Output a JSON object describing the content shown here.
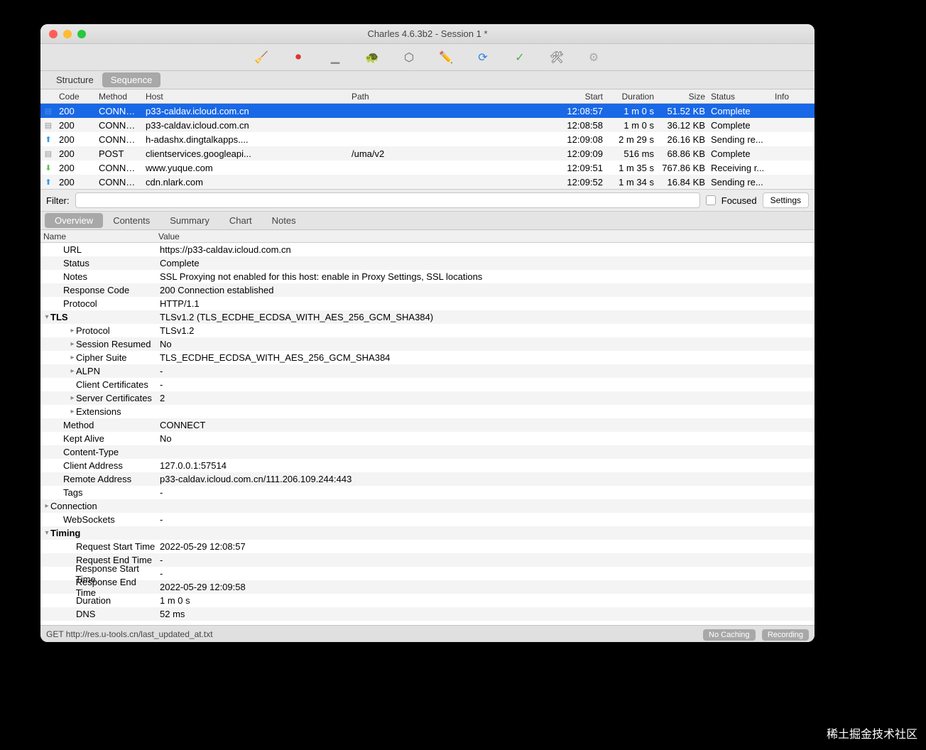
{
  "window": {
    "title": "Charles 4.6.3b2 - Session 1 *"
  },
  "modeTabs": {
    "structure": "Structure",
    "sequence": "Sequence"
  },
  "columns": {
    "code": "Code",
    "method": "Method",
    "host": "Host",
    "path": "Path",
    "start": "Start",
    "duration": "Duration",
    "size": "Size",
    "status": "Status",
    "info": "Info"
  },
  "rows": [
    {
      "icon": "doc",
      "iconColor": "#4a90e2",
      "code": "200",
      "method": "CONNECT",
      "host": "p33-caldav.icloud.com.cn",
      "path": "",
      "start": "12:08:57",
      "duration": "1 m 0 s",
      "size": "51.52 KB",
      "status": "Complete",
      "selected": true
    },
    {
      "icon": "doc",
      "iconColor": "#999",
      "code": "200",
      "method": "CONNECT",
      "host": "p33-caldav.icloud.com.cn",
      "path": "",
      "start": "12:08:58",
      "duration": "1 m 0 s",
      "size": "36.12 KB",
      "status": "Complete"
    },
    {
      "icon": "up",
      "iconColor": "#2e9ae6",
      "code": "200",
      "method": "CONNECT",
      "host": "h-adashx.dingtalkapps....",
      "path": "",
      "start": "12:09:08",
      "duration": "2 m 29 s",
      "size": "26.16 KB",
      "status": "Sending re..."
    },
    {
      "icon": "doc",
      "iconColor": "#999",
      "code": "200",
      "method": "POST",
      "host": "clientservices.googleapi...",
      "path": "/uma/v2",
      "start": "12:09:09",
      "duration": "516 ms",
      "size": "68.86 KB",
      "status": "Complete"
    },
    {
      "icon": "down",
      "iconColor": "#5fc24a",
      "code": "200",
      "method": "CONNECT",
      "host": "www.yuque.com",
      "path": "",
      "start": "12:09:51",
      "duration": "1 m 35 s",
      "size": "767.86 KB",
      "status": "Receiving r..."
    },
    {
      "icon": "up",
      "iconColor": "#2e9ae6",
      "code": "200",
      "method": "CONNECT",
      "host": "cdn.nlark.com",
      "path": "",
      "start": "12:09:52",
      "duration": "1 m 34 s",
      "size": "16.84 KB",
      "status": "Sending re..."
    }
  ],
  "filter": {
    "label": "Filter:",
    "focused": "Focused",
    "settings": "Settings"
  },
  "detailTabs": {
    "overview": "Overview",
    "contents": "Contents",
    "summary": "Summary",
    "chart": "Chart",
    "notes": "Notes"
  },
  "ovHeader": {
    "name": "Name",
    "value": "Value"
  },
  "overview": [
    {
      "indent": 1,
      "name": "URL",
      "value": "https://p33-caldav.icloud.com.cn"
    },
    {
      "indent": 1,
      "name": "Status",
      "value": "Complete"
    },
    {
      "indent": 1,
      "name": "Notes",
      "value": "SSL Proxying not enabled for this host: enable in Proxy Settings, SSL locations"
    },
    {
      "indent": 1,
      "name": "Response Code",
      "value": "200 Connection established"
    },
    {
      "indent": 1,
      "name": "Protocol",
      "value": "HTTP/1.1"
    },
    {
      "indent": 0,
      "disc": "open",
      "bold": true,
      "name": "TLS",
      "value": "TLSv1.2 (TLS_ECDHE_ECDSA_WITH_AES_256_GCM_SHA384)"
    },
    {
      "indent": 2,
      "disc": "closed",
      "name": "Protocol",
      "value": "TLSv1.2"
    },
    {
      "indent": 2,
      "disc": "closed",
      "name": "Session Resumed",
      "value": "No"
    },
    {
      "indent": 2,
      "disc": "closed",
      "name": "Cipher Suite",
      "value": "TLS_ECDHE_ECDSA_WITH_AES_256_GCM_SHA384"
    },
    {
      "indent": 2,
      "disc": "closed",
      "name": "ALPN",
      "value": "-"
    },
    {
      "indent": 2,
      "name": "Client Certificates",
      "value": "-"
    },
    {
      "indent": 2,
      "disc": "closed",
      "name": "Server Certificates",
      "value": "2"
    },
    {
      "indent": 2,
      "disc": "closed",
      "name": "Extensions",
      "value": ""
    },
    {
      "indent": 1,
      "name": "Method",
      "value": "CONNECT"
    },
    {
      "indent": 1,
      "name": "Kept Alive",
      "value": "No"
    },
    {
      "indent": 1,
      "name": "Content-Type",
      "value": ""
    },
    {
      "indent": 1,
      "name": "Client Address",
      "value": "127.0.0.1:57514"
    },
    {
      "indent": 1,
      "name": "Remote Address",
      "value": "p33-caldav.icloud.com.cn/111.206.109.244:443"
    },
    {
      "indent": 1,
      "name": "Tags",
      "value": "-"
    },
    {
      "indent": 0,
      "disc": "closed",
      "name": "Connection",
      "value": ""
    },
    {
      "indent": 1,
      "name": "WebSockets",
      "value": "-"
    },
    {
      "indent": 0,
      "disc": "open",
      "bold": true,
      "name": "Timing",
      "value": ""
    },
    {
      "indent": 2,
      "name": "Request Start Time",
      "value": "2022-05-29 12:08:57"
    },
    {
      "indent": 2,
      "name": "Request End Time",
      "value": "-"
    },
    {
      "indent": 2,
      "name": "Response Start Time",
      "value": "-"
    },
    {
      "indent": 2,
      "name": "Response End Time",
      "value": "2022-05-29 12:09:58"
    },
    {
      "indent": 2,
      "name": "Duration",
      "value": "1 m 0 s"
    },
    {
      "indent": 2,
      "name": "DNS",
      "value": "52 ms"
    }
  ],
  "statusbar": {
    "text": "GET http://res.u-tools.cn/last_updated_at.txt",
    "noCaching": "No Caching",
    "recording": "Recording"
  },
  "watermark": "稀土掘金技术社区"
}
